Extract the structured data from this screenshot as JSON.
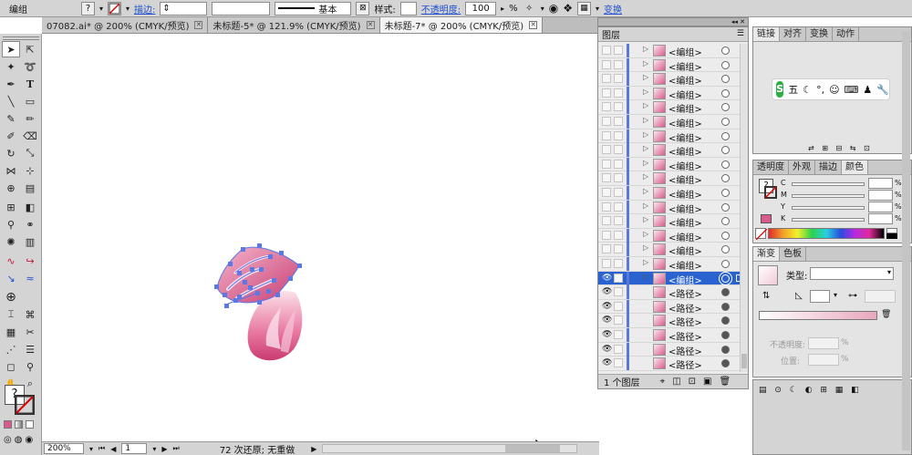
{
  "control_bar": {
    "selection_type": "编组",
    "question_mark": "?",
    "stroke_label": "描边:",
    "stroke_style": "基本",
    "style_label": "样式:",
    "opacity_label": "不透明度:",
    "opacity_value": "100",
    "opacity_unit": "%",
    "transform_label": "变换"
  },
  "doc_tabs": [
    {
      "label": "07082.ai* @ 200% (CMYK/预览)",
      "active": false
    },
    {
      "label": "未标题-5* @ 121.9% (CMYK/预览)",
      "active": false
    },
    {
      "label": "未标题-7* @ 200% (CMYK/预览)",
      "active": true
    }
  ],
  "status": {
    "zoom": "200%",
    "page": "1",
    "history": "72 次还原; 无重做"
  },
  "layers_panel": {
    "title": "图层",
    "footer": "1 个图层",
    "rows": [
      {
        "name": "<编组>",
        "type": "group",
        "visible": false,
        "selected": false
      },
      {
        "name": "<编组>",
        "type": "group",
        "visible": false,
        "selected": false
      },
      {
        "name": "<编组>",
        "type": "group",
        "visible": false,
        "selected": false
      },
      {
        "name": "<编组>",
        "type": "group",
        "visible": false,
        "selected": false
      },
      {
        "name": "<编组>",
        "type": "group",
        "visible": false,
        "selected": false
      },
      {
        "name": "<编组>",
        "type": "group",
        "visible": false,
        "selected": false
      },
      {
        "name": "<编组>",
        "type": "group",
        "visible": false,
        "selected": false
      },
      {
        "name": "<编组>",
        "type": "group",
        "visible": false,
        "selected": false
      },
      {
        "name": "<编组>",
        "type": "group",
        "visible": false,
        "selected": false
      },
      {
        "name": "<编组>",
        "type": "group",
        "visible": false,
        "selected": false
      },
      {
        "name": "<编组>",
        "type": "group",
        "visible": false,
        "selected": false
      },
      {
        "name": "<编组>",
        "type": "group",
        "visible": false,
        "selected": false
      },
      {
        "name": "<编组>",
        "type": "group",
        "visible": false,
        "selected": false
      },
      {
        "name": "<编组>",
        "type": "group",
        "visible": false,
        "selected": false
      },
      {
        "name": "<编组>",
        "type": "group",
        "visible": false,
        "selected": false
      },
      {
        "name": "<编组>",
        "type": "group",
        "visible": false,
        "selected": false
      },
      {
        "name": "<编组>",
        "type": "group",
        "visible": true,
        "selected": true
      },
      {
        "name": "<路径>",
        "type": "path",
        "visible": true,
        "selected": false
      },
      {
        "name": "<路径>",
        "type": "path",
        "visible": true,
        "selected": false
      },
      {
        "name": "<路径>",
        "type": "path",
        "visible": true,
        "selected": false
      },
      {
        "name": "<路径>",
        "type": "path",
        "visible": true,
        "selected": false
      },
      {
        "name": "<路径>",
        "type": "path",
        "visible": true,
        "selected": false
      },
      {
        "name": "<路径>",
        "type": "path",
        "visible": true,
        "selected": false
      }
    ]
  },
  "top_right_tabs": [
    "链接",
    "对齐",
    "变换",
    "动作"
  ],
  "ime_toolbar_text": "五",
  "color_panel_tabs": [
    "透明度",
    "外观",
    "描边",
    "颜色"
  ],
  "cmyk_channels": [
    "C",
    "M",
    "Y",
    "K"
  ],
  "percent_sign": "%",
  "gradient_panel_tabs": [
    "渐变",
    "色板"
  ],
  "gradient_type_label": "类型:",
  "gradient_opacity_label": "不透明度:",
  "gradient_location_label": "位置:",
  "colors": {
    "selection_blue": "#2a63cf",
    "anchor_blue": "#5a78e6",
    "petal_pink": "#d95b8d",
    "ime_green": "#2fae45"
  }
}
